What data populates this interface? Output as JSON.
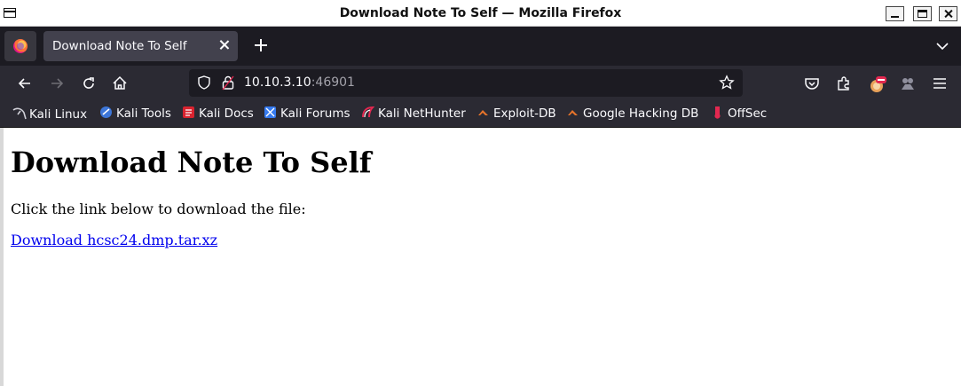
{
  "window": {
    "title": "Download Note To Self — Mozilla Firefox"
  },
  "tabs": [
    {
      "label": "Download Note To Self",
      "active": true
    }
  ],
  "urlbar": {
    "host": "10.10.3.10",
    "port": ":46901"
  },
  "bookmarks": [
    {
      "label": "Kali Linux",
      "icon": "kali-dragon-icon"
    },
    {
      "label": "Kali Tools",
      "icon": "kali-tools-icon"
    },
    {
      "label": "Kali Docs",
      "icon": "kali-docs-icon"
    },
    {
      "label": "Kali Forums",
      "icon": "kali-forums-icon"
    },
    {
      "label": "Kali NetHunter",
      "icon": "nethunter-icon"
    },
    {
      "label": "Exploit-DB",
      "icon": "exploit-db-icon"
    },
    {
      "label": "Google Hacking DB",
      "icon": "ghdb-icon"
    },
    {
      "label": "OffSec",
      "icon": "offsec-icon"
    }
  ],
  "page": {
    "title": "Download Note To Self",
    "instruction": "Click the link below to download the file:",
    "link_text": "Download hcsc24.dmp.tar.xz"
  },
  "colors": {
    "tabstrip": "#1c1b22",
    "toolbar": "#2b2a33",
    "link": "#0000ee"
  }
}
